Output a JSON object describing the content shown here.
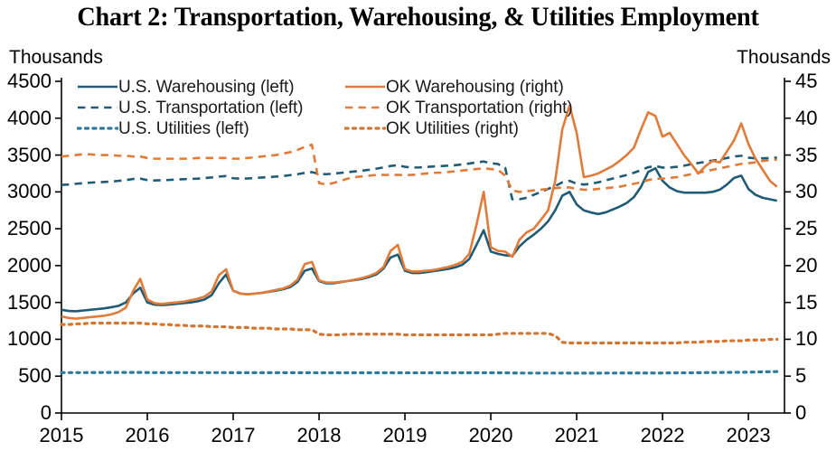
{
  "title": "Chart 2: Transportation, Warehousing, & Utilities Employment",
  "axis": {
    "left_unit": "Thousands",
    "right_unit": "Thousands"
  },
  "legend": {
    "left_column": [
      {
        "label": "U.S. Warehousing (left)",
        "style": "solid",
        "color": "#1f5b75"
      },
      {
        "label": "U.S. Transportation (left)",
        "style": "dashed",
        "color": "#1f5b75"
      },
      {
        "label": "U.S. Utilities (left)",
        "style": "dotted",
        "color": "#2e7b9c"
      }
    ],
    "right_column": [
      {
        "label": "OK Warehousing (right)",
        "style": "solid",
        "color": "#e07b39"
      },
      {
        "label": "OK Transportation (right)",
        "style": "dashed",
        "color": "#e07b39"
      },
      {
        "label": "OK Utilities (right)",
        "style": "dotted",
        "color": "#d4762f"
      }
    ]
  },
  "chart_data": {
    "type": "line",
    "title": "Chart 2: Transportation, Warehousing, & Utilities Employment",
    "xlabel": "",
    "ylabel": "Thousands",
    "y2label": "Thousands",
    "grid": false,
    "legend_position": "top-left",
    "xlim": [
      2015.0,
      2023.42
    ],
    "ylim": [
      0,
      4500
    ],
    "y2lim": [
      0,
      45
    ],
    "ytick_labels": [
      "0",
      "500",
      "1000",
      "1500",
      "2000",
      "2500",
      "3000",
      "3500",
      "4000",
      "4500"
    ],
    "ytick_values": [
      0,
      500,
      1000,
      1500,
      2000,
      2500,
      3000,
      3500,
      4000,
      4500
    ],
    "y2tick_labels": [
      "0",
      "5",
      "10",
      "15",
      "20",
      "25",
      "30",
      "35",
      "40",
      "45"
    ],
    "y2tick_values": [
      0,
      5,
      10,
      15,
      20,
      25,
      30,
      35,
      40,
      45
    ],
    "xtick_labels": [
      "2015",
      "2016",
      "2017",
      "2018",
      "2019",
      "2020",
      "2021",
      "2022",
      "2023"
    ],
    "xtick_values": [
      2015,
      2016,
      2017,
      2018,
      2019,
      2020,
      2021,
      2022,
      2023
    ],
    "x": [
      2015.0,
      2015.083,
      2015.167,
      2015.25,
      2015.333,
      2015.417,
      2015.5,
      2015.583,
      2015.667,
      2015.75,
      2015.833,
      2015.917,
      2016.0,
      2016.083,
      2016.167,
      2016.25,
      2016.333,
      2016.417,
      2016.5,
      2016.583,
      2016.667,
      2016.75,
      2016.833,
      2016.917,
      2017.0,
      2017.083,
      2017.167,
      2017.25,
      2017.333,
      2017.417,
      2017.5,
      2017.583,
      2017.667,
      2017.75,
      2017.833,
      2017.917,
      2018.0,
      2018.083,
      2018.167,
      2018.25,
      2018.333,
      2018.417,
      2018.5,
      2018.583,
      2018.667,
      2018.75,
      2018.833,
      2018.917,
      2019.0,
      2019.083,
      2019.167,
      2019.25,
      2019.333,
      2019.417,
      2019.5,
      2019.583,
      2019.667,
      2019.75,
      2019.833,
      2019.917,
      2020.0,
      2020.083,
      2020.167,
      2020.25,
      2020.333,
      2020.417,
      2020.5,
      2020.583,
      2020.667,
      2020.75,
      2020.833,
      2020.917,
      2021.0,
      2021.083,
      2021.167,
      2021.25,
      2021.333,
      2021.417,
      2021.5,
      2021.583,
      2021.667,
      2021.75,
      2021.833,
      2021.917,
      2022.0,
      2022.083,
      2022.167,
      2022.25,
      2022.333,
      2022.417,
      2022.5,
      2022.583,
      2022.667,
      2022.75,
      2022.833,
      2022.917,
      2023.0,
      2023.083,
      2023.167,
      2023.25,
      2023.333
    ],
    "series": [
      {
        "name": "U.S. Warehousing (left)",
        "axis": "left",
        "style": "solid",
        "color": "#1f5b75",
        "values": [
          1400,
          1385,
          1380,
          1390,
          1400,
          1410,
          1420,
          1435,
          1455,
          1500,
          1620,
          1700,
          1500,
          1470,
          1465,
          1470,
          1480,
          1490,
          1500,
          1515,
          1540,
          1600,
          1760,
          1880,
          1660,
          1620,
          1610,
          1620,
          1630,
          1645,
          1660,
          1680,
          1710,
          1780,
          1930,
          1960,
          1790,
          1760,
          1760,
          1775,
          1790,
          1805,
          1820,
          1845,
          1880,
          1960,
          2110,
          2150,
          1930,
          1900,
          1900,
          1910,
          1925,
          1940,
          1955,
          1975,
          2010,
          2090,
          2280,
          2480,
          2190,
          2160,
          2140,
          2130,
          2260,
          2350,
          2420,
          2500,
          2600,
          2750,
          2950,
          3000,
          2830,
          2750,
          2720,
          2700,
          2720,
          2760,
          2800,
          2850,
          2930,
          3070,
          3270,
          3320,
          3150,
          3060,
          3010,
          2990,
          2990,
          2990,
          2990,
          3000,
          3030,
          3100,
          3190,
          3220,
          3040,
          2960,
          2920,
          2900,
          2880
        ]
      },
      {
        "name": "U.S. Transportation (left)",
        "axis": "left",
        "style": "dashed",
        "color": "#1f5b75",
        "values": [
          3095,
          3100,
          3110,
          3118,
          3125,
          3130,
          3135,
          3140,
          3150,
          3160,
          3175,
          3180,
          3160,
          3155,
          3158,
          3162,
          3168,
          3172,
          3176,
          3180,
          3188,
          3196,
          3208,
          3215,
          3185,
          3180,
          3182,
          3188,
          3195,
          3200,
          3208,
          3215,
          3228,
          3240,
          3258,
          3268,
          3245,
          3240,
          3248,
          3258,
          3268,
          3278,
          3288,
          3300,
          3315,
          3332,
          3352,
          3362,
          3340,
          3330,
          3332,
          3338,
          3345,
          3350,
          3356,
          3362,
          3372,
          3385,
          3402,
          3412,
          3390,
          3378,
          3330,
          2900,
          2900,
          2920,
          2960,
          3000,
          3040,
          3080,
          3130,
          3150,
          3110,
          3100,
          3110,
          3130,
          3155,
          3180,
          3205,
          3230,
          3260,
          3295,
          3335,
          3350,
          3330,
          3330,
          3340,
          3355,
          3375,
          3392,
          3408,
          3425,
          3440,
          3460,
          3480,
          3490,
          3465,
          3455,
          3455,
          3460,
          3465
        ]
      },
      {
        "name": "U.S. Utilities (left)",
        "axis": "left",
        "style": "dotted",
        "color": "#2e7b9c",
        "values": [
          548,
          548,
          548,
          548,
          549,
          549,
          550,
          550,
          550,
          550,
          550,
          550,
          549,
          548,
          548,
          548,
          548,
          548,
          548,
          548,
          548,
          548,
          548,
          548,
          547,
          547,
          547,
          547,
          547,
          547,
          547,
          547,
          547,
          547,
          547,
          547,
          546,
          546,
          546,
          546,
          546,
          546,
          546,
          546,
          546,
          546,
          546,
          546,
          545,
          545,
          545,
          545,
          546,
          546,
          546,
          546,
          546,
          546,
          546,
          546,
          546,
          546,
          545,
          543,
          542,
          542,
          542,
          542,
          542,
          542,
          542,
          542,
          541,
          541,
          541,
          541,
          542,
          542,
          542,
          543,
          543,
          543,
          543,
          543,
          543,
          544,
          544,
          545,
          546,
          547,
          548,
          549,
          550,
          551,
          552,
          553,
          554,
          556,
          558,
          560,
          562
        ]
      },
      {
        "name": "OK Warehousing (right)",
        "axis": "right",
        "style": "solid",
        "color": "#e07b39",
        "values": [
          13.1,
          12.9,
          12.8,
          12.9,
          13.0,
          13.1,
          13.2,
          13.4,
          13.7,
          14.3,
          16.5,
          18.2,
          15.4,
          14.9,
          14.8,
          14.9,
          15.0,
          15.1,
          15.3,
          15.5,
          15.8,
          16.5,
          18.7,
          19.5,
          16.6,
          16.2,
          16.1,
          16.2,
          16.3,
          16.5,
          16.7,
          16.9,
          17.3,
          18.1,
          20.2,
          20.5,
          18.0,
          17.7,
          17.7,
          17.8,
          17.9,
          18.1,
          18.3,
          18.6,
          19.0,
          19.8,
          22.0,
          22.8,
          19.5,
          19.2,
          19.2,
          19.3,
          19.4,
          19.6,
          19.8,
          20.1,
          20.5,
          21.6,
          25.5,
          30.0,
          22.5,
          22.0,
          21.9,
          21.2,
          23.5,
          24.5,
          25.0,
          26.2,
          27.5,
          31.5,
          38.5,
          41.7,
          38.0,
          32.0,
          32.2,
          32.5,
          33.0,
          33.5,
          34.2,
          35.0,
          36.0,
          38.5,
          40.8,
          40.3,
          37.5,
          38.0,
          36.5,
          35.0,
          33.8,
          32.5,
          33.5,
          34.2,
          34.0,
          35.5,
          37.0,
          39.3,
          36.5,
          34.5,
          33.0,
          31.5,
          30.7
        ]
      },
      {
        "name": "OK Transportation (right)",
        "axis": "right",
        "style": "dashed",
        "color": "#e07b39",
        "values": [
          34.8,
          34.9,
          35.0,
          35.1,
          35.1,
          35.0,
          35.0,
          35.0,
          34.9,
          34.9,
          34.8,
          34.8,
          34.6,
          34.5,
          34.5,
          34.5,
          34.5,
          34.5,
          34.5,
          34.6,
          34.6,
          34.6,
          34.6,
          34.6,
          34.5,
          34.5,
          34.6,
          34.7,
          34.8,
          34.9,
          35.0,
          35.2,
          35.4,
          35.7,
          36.1,
          36.4,
          31.2,
          31.0,
          31.2,
          31.5,
          31.8,
          32.0,
          32.1,
          32.2,
          32.3,
          32.3,
          32.3,
          32.3,
          32.3,
          32.3,
          32.4,
          32.5,
          32.6,
          32.6,
          32.7,
          32.8,
          32.9,
          33.0,
          33.1,
          33.2,
          33.1,
          33.0,
          32.2,
          30.2,
          30.0,
          30.1,
          30.2,
          30.3,
          30.4,
          30.5,
          30.6,
          30.6,
          30.4,
          30.3,
          30.3,
          30.4,
          30.5,
          30.6,
          30.7,
          30.9,
          31.1,
          31.3,
          31.6,
          31.8,
          31.8,
          31.9,
          32.0,
          32.2,
          32.4,
          32.6,
          32.8,
          33.0,
          33.2,
          33.4,
          33.6,
          33.8,
          33.9,
          34.0,
          34.2,
          34.3,
          34.4
        ]
      },
      {
        "name": "OK Utilities (right)",
        "axis": "right",
        "style": "dotted",
        "color": "#d4762f",
        "values": [
          12.0,
          12.0,
          12.1,
          12.1,
          12.2,
          12.2,
          12.2,
          12.2,
          12.2,
          12.2,
          12.2,
          12.2,
          12.1,
          12.1,
          12.0,
          12.0,
          11.9,
          11.9,
          11.8,
          11.8,
          11.8,
          11.7,
          11.7,
          11.7,
          11.6,
          11.6,
          11.6,
          11.5,
          11.5,
          11.5,
          11.4,
          11.4,
          11.4,
          11.3,
          11.3,
          11.3,
          10.7,
          10.6,
          10.6,
          10.6,
          10.7,
          10.7,
          10.7,
          10.7,
          10.7,
          10.7,
          10.7,
          10.7,
          10.6,
          10.6,
          10.6,
          10.6,
          10.6,
          10.6,
          10.6,
          10.6,
          10.6,
          10.6,
          10.6,
          10.6,
          10.6,
          10.7,
          10.8,
          10.8,
          10.8,
          10.8,
          10.8,
          10.8,
          10.8,
          10.5,
          9.6,
          9.5,
          9.5,
          9.5,
          9.5,
          9.5,
          9.5,
          9.5,
          9.5,
          9.5,
          9.5,
          9.5,
          9.5,
          9.5,
          9.5,
          9.5,
          9.5,
          9.6,
          9.6,
          9.6,
          9.7,
          9.7,
          9.7,
          9.8,
          9.8,
          9.8,
          9.9,
          9.9,
          9.9,
          10.0,
          10.0
        ]
      }
    ]
  }
}
